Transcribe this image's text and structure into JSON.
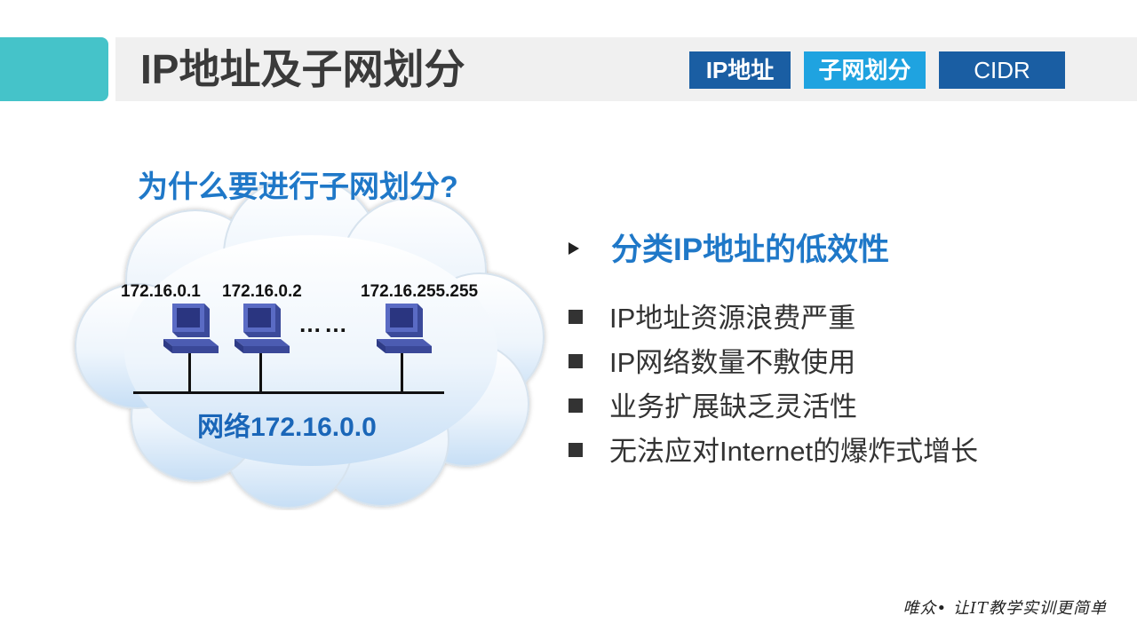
{
  "header": {
    "title": "IP地址及子网划分",
    "tabs": [
      {
        "label": "IP地址"
      },
      {
        "label": "子网划分"
      },
      {
        "label": "CIDR"
      }
    ]
  },
  "diagram": {
    "question": "为什么要进行子网划分?",
    "hosts": [
      {
        "ip": "172.16.0.1"
      },
      {
        "ip": "172.16.0.2"
      },
      {
        "ip": "172.16.255.255"
      }
    ],
    "ellipsis": "……",
    "network": "网络172.16.0.0"
  },
  "content": {
    "heading": "分类IP地址的低效性",
    "bullets": [
      "IP地址资源浪费严重",
      "IP网络数量不敷使用",
      "业务扩展缺乏灵活性",
      "无法应对Internet的爆炸式增长"
    ]
  },
  "footer": {
    "slogan": "唯众• 让IT教学实训更简单"
  },
  "colors": {
    "accent_teal": "#45c3c9",
    "tab_dark_blue": "#1a5ea3",
    "tab_light_blue": "#1fa3e0",
    "heading_blue": "#1f78c8",
    "network_label_blue": "#1a66b8"
  }
}
